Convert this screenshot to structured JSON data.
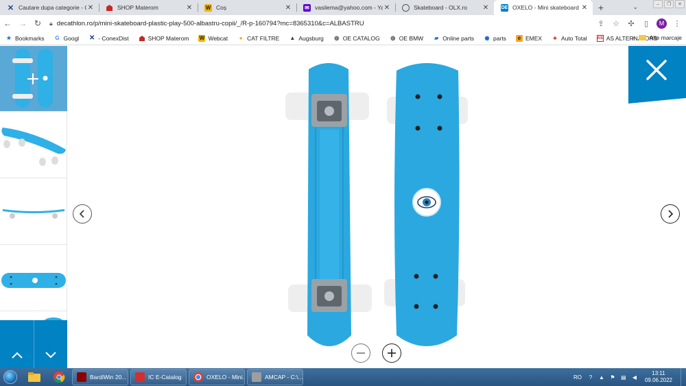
{
  "tabs": [
    {
      "title": "Cautare dupa categorie - Conex",
      "favicon": "conexdist-x-icon",
      "active": false
    },
    {
      "title": "SHOP Materom",
      "favicon": "materom-icon",
      "active": false
    },
    {
      "title": "Coș",
      "favicon": "webcat-icon",
      "active": false
    },
    {
      "title": "vasilema@yahoo.com - Yahoo",
      "favicon": "yahoo-mail-icon",
      "active": false
    },
    {
      "title": "Skateboard - OLX.ro",
      "favicon": "olx-icon",
      "active": false
    },
    {
      "title": "OXELO - Mini skateboard plastic",
      "favicon": "decathlon-icon",
      "active": true
    }
  ],
  "omnibox": {
    "url": "decathlon.ro/p/mini-skateboard-plastic-play-500-albastru-copii/_/R-p-160794?mc=8365310&c=ALBASTRU"
  },
  "profile_initial": "M",
  "bookmarks": [
    {
      "label": "Bookmarks",
      "icon": "star-icon"
    },
    {
      "label": "Googl",
      "icon": "google-icon"
    },
    {
      "label": "- ConexDist",
      "icon": "conexdist-x-icon"
    },
    {
      "label": "SHOP Materom",
      "icon": "materom-icon"
    },
    {
      "label": "Webcat",
      "icon": "webcat-icon"
    },
    {
      "label": "CAT FILTRE",
      "icon": "drop-icon"
    },
    {
      "label": "Augsburg",
      "icon": "augsburg-icon"
    },
    {
      "label": "OE CATALOG",
      "icon": "globe-icon"
    },
    {
      "label": "OE BMW",
      "icon": "globe-icon"
    },
    {
      "label": "Online parts",
      "icon": "parts-icon"
    },
    {
      "label": "parts",
      "icon": "parts-p-icon"
    },
    {
      "label": "EMEX",
      "icon": "emex-icon"
    },
    {
      "label": "Auto Total",
      "icon": "autototal-icon"
    },
    {
      "label": "AS ALTERNATORS",
      "icon": "as-icon"
    }
  ],
  "bookmarks_more": "»",
  "bookmarks_other": "Alte marcaje",
  "gallery": {
    "thumbnails": [
      "front-and-back",
      "perspective",
      "side",
      "top",
      "partial"
    ],
    "selected": 0,
    "close_label": "close",
    "accent": "#0082c3"
  },
  "taskbar": {
    "tasks": [
      {
        "label": "BardiWin 20...",
        "icon": "bardiwin-icon"
      },
      {
        "label": "IC E-Catalog",
        "icon": "ic-catalog-icon"
      },
      {
        "label": "OXELO - Mini...",
        "icon": "chrome-icon"
      },
      {
        "label": "AMCAP - C:\\...",
        "icon": "amcap-icon"
      }
    ],
    "lang": "RO",
    "time": "13:11",
    "date": "09.06.2022"
  }
}
